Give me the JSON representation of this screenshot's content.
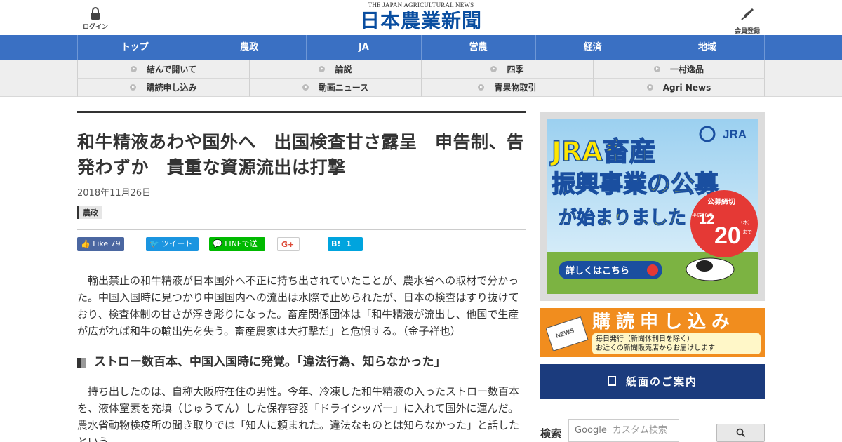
{
  "header": {
    "login_label": "ログイン",
    "member_label": "会員登録",
    "logo_en": "THE JAPAN AGRICULTURAL NEWS",
    "logo_jp": "日本農業新聞"
  },
  "main_nav": [
    "トップ",
    "農政",
    "JA",
    "営農",
    "経済",
    "地域"
  ],
  "sub_nav": [
    "結んで開いて",
    "論説",
    "四季",
    "一村逸品",
    "購読申し込み",
    "動画ニュース",
    "青果物取引",
    "Agri News"
  ],
  "article": {
    "title": "和牛精液あわや国外へ　出国検査甘さ露呈　申告制、告発わずか　貴重な資源流出は打撃",
    "date": "2018年11月26日",
    "category": "農政",
    "paragraph1": "輸出禁止の和牛精液が日本国外へ不正に持ち出されていたことが、農水省への取材で分かった。中国入国時に見つかり中国国内への流出は水際で止められたが、日本の検査はすり抜けており、検査体制の甘さが浮き彫りになった。畜産関係団体は「和牛精液が流出し、他国で生産が広がれば和牛の輸出先を失う。畜産農家は大打撃だ」と危惧する。（金子祥也）",
    "subheading": "ストロー数百本、中国入国時に発覚。「違法行為、知らなかった」",
    "paragraph2": "持ち出したのは、自称大阪府在住の男性。今年、冷凍した和牛精液の入ったストロー数百本を、液体窒素を充填（じゅうてん）した保存容器「ドライシッパー」に入れて国外に運んだ。農水省動物検疫所の聞き取りでは「知人に頼まれた。違法なものとは知らなかった」と話したという。"
  },
  "share": {
    "facebook_label": "Like",
    "facebook_count": "79",
    "twitter_label": "ツイート",
    "line_label": "LINEで送る",
    "gplus_label": "G+",
    "hatena_label": "B!",
    "hatena_count": "1"
  },
  "sidebar": {
    "ad_jra": {
      "logo": "JRA",
      "line1": "JRA畜産",
      "line2": "振興事業の公募",
      "line3": "が始まりました",
      "deadline_label": "公募締切",
      "era": "平成30年",
      "month": "12",
      "day": "20",
      "weekday": "(木)",
      "until": "まで",
      "cta": "詳しくはこちら"
    },
    "ad_subscribe": {
      "title": "購読申し込み",
      "note1": "毎日発行（新聞休刊日を除く）",
      "note2": "お近くの新聞販売店からお届けします",
      "icon_text": "NEWS"
    },
    "paper_guide": "紙面のご案内",
    "search": {
      "label": "検索",
      "placeholder": "カスタム検索",
      "brand": "Google"
    }
  }
}
